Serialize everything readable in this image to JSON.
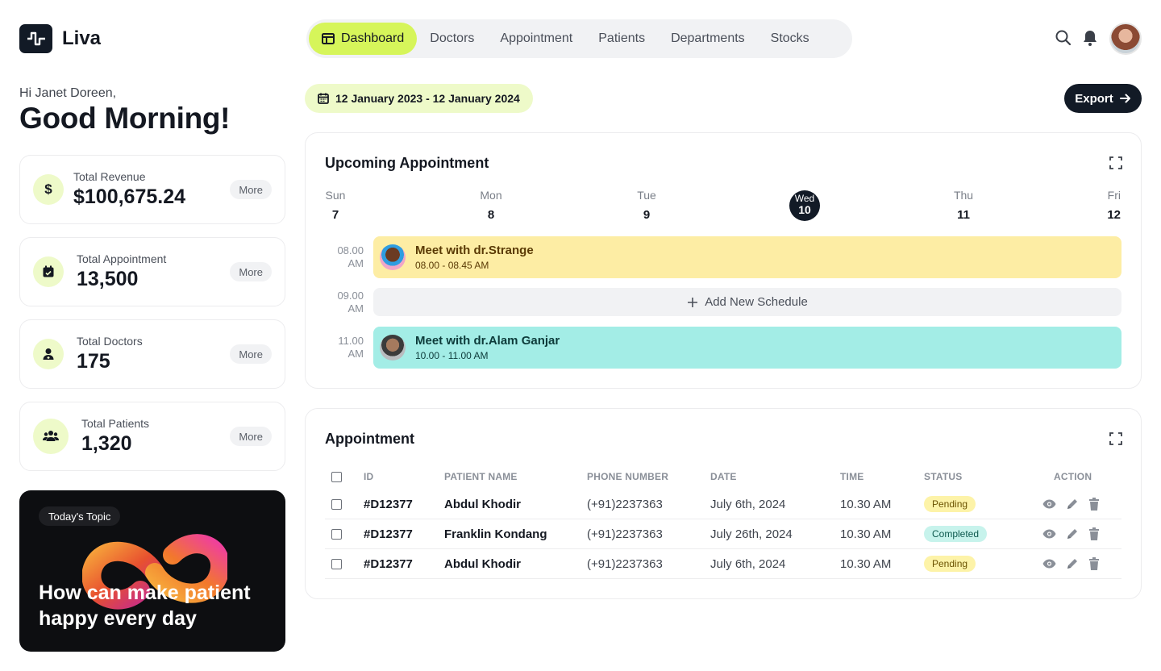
{
  "app": {
    "name": "Liva"
  },
  "nav": {
    "items": [
      "Dashboard",
      "Doctors",
      "Appointment",
      "Patients",
      "Departments",
      "Stocks"
    ],
    "active": "Dashboard"
  },
  "header": {
    "icons": [
      "search-icon",
      "bell-icon"
    ],
    "avatar": "user-avatar"
  },
  "greeting": {
    "hi": "Hi Janet Doreen,",
    "title": "Good Morning!"
  },
  "stats": [
    {
      "label": "Total Revenue",
      "value": "$100,675.24",
      "more": "More",
      "icon": "dollar-icon"
    },
    {
      "label": "Total Appointment",
      "value": "13,500",
      "more": "More",
      "icon": "calendar-check-icon"
    },
    {
      "label": "Total Doctors",
      "value": "175",
      "more": "More",
      "icon": "doctor-icon"
    },
    {
      "label": "Total Patients",
      "value": "1,320",
      "more": "More",
      "icon": "users-icon"
    }
  ],
  "topic": {
    "chip": "Today's Topic",
    "title": "How can make patient happy every day"
  },
  "date_range": "12 January 2023 - 12 January 2024",
  "export_label": "Export",
  "upcoming": {
    "title": "Upcoming Appointment",
    "days": [
      {
        "name": "Sun",
        "date": "7"
      },
      {
        "name": "Mon",
        "date": "8"
      },
      {
        "name": "Tue",
        "date": "9"
      },
      {
        "name": "Wed",
        "date": "10"
      },
      {
        "name": "Thu",
        "date": "11"
      },
      {
        "name": "Fri",
        "date": "12"
      }
    ],
    "active_day": "Wed",
    "slots": [
      {
        "time_a": "08.00",
        "time_b": "AM"
      },
      {
        "time_a": "09.00",
        "time_b": "AM"
      },
      {
        "time_a": "11.00",
        "time_b": "AM"
      }
    ],
    "events": [
      {
        "title": "Meet with dr.Strange",
        "time": "08.00 - 08.45 AM",
        "color": "#fdeda4",
        "text_color": "#5a3a05"
      },
      {
        "title": "Meet with dr.Alam Ganjar",
        "time": "10.00 - 11.00 AM",
        "color": "#a3ede6",
        "text_color": "#0d3b3a"
      }
    ],
    "add_label": "Add New Schedule"
  },
  "appointments": {
    "title": "Appointment",
    "columns": [
      "ID",
      "PATIENT NAME",
      "PHONE NUMBER",
      "DATE",
      "TIME",
      "STATUS",
      "ACTION"
    ],
    "rows": [
      {
        "id": "#D12377",
        "name": "Abdul Khodir",
        "phone": "(+91)2237363",
        "date": "July 6th, 2024",
        "time": "10.30 AM",
        "status": "Pending"
      },
      {
        "id": "#D12377",
        "name": "Franklin Kondang",
        "phone": "(+91)2237363",
        "date": "July 26th, 2024",
        "time": "10.30 AM",
        "status": "Completed"
      },
      {
        "id": "#D12377",
        "name": "Abdul Khodir",
        "phone": "(+91)2237363",
        "date": "July 6th, 2024",
        "time": "10.30 AM",
        "status": "Pending"
      }
    ],
    "status_colors": {
      "Pending": "#fdf3a8",
      "Completed": "#c7f3ec"
    },
    "status_text_colors": {
      "Pending": "#6b5200",
      "Completed": "#0e5a4f"
    }
  },
  "colors": {
    "accent": "#d6f55a",
    "dark": "#121a26",
    "accent_soft": "#eefac9"
  }
}
